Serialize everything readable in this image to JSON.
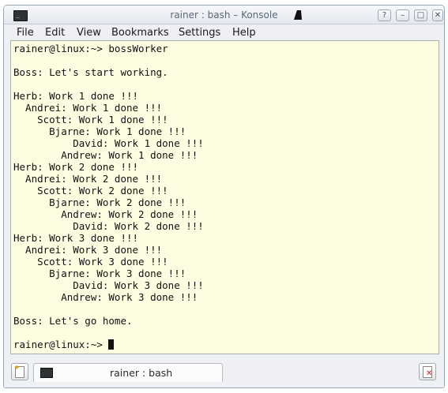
{
  "window": {
    "title": "rainer : bash – Konsole",
    "app_icon_glyph": "_",
    "buttons": {
      "help": "?",
      "minimize": "–",
      "maximize": "□",
      "close": "✕"
    }
  },
  "menu": [
    "File",
    "Edit",
    "View",
    "Bookmarks",
    "Settings",
    "Help"
  ],
  "terminal": {
    "background": "#fdfde1",
    "lines": [
      "rainer@linux:~> bossWorker",
      "",
      "Boss: Let's start working.",
      "",
      "Herb: Work 1 done !!!",
      "  Andrei: Work 1 done !!!",
      "    Scott: Work 1 done !!!",
      "      Bjarne: Work 1 done !!!",
      "          David: Work 1 done !!!",
      "        Andrew: Work 1 done !!!",
      "Herb: Work 2 done !!!",
      "  Andrei: Work 2 done !!!",
      "    Scott: Work 2 done !!!",
      "      Bjarne: Work 2 done !!!",
      "        Andrew: Work 2 done !!!",
      "          David: Work 2 done !!!",
      "Herb: Work 3 done !!!",
      "  Andrei: Work 3 done !!!",
      "    Scott: Work 3 done !!!",
      "      Bjarne: Work 3 done !!!",
      "          David: Work 3 done !!!",
      "        Andrew: Work 3 done !!!",
      "",
      "Boss: Let's go home.",
      ""
    ],
    "prompt": "rainer@linux:~> "
  },
  "tabs": {
    "new_tab_icon": "new-tab-icon",
    "close_tab_icon": "close-tab-icon",
    "active_label": "rainer : bash"
  }
}
